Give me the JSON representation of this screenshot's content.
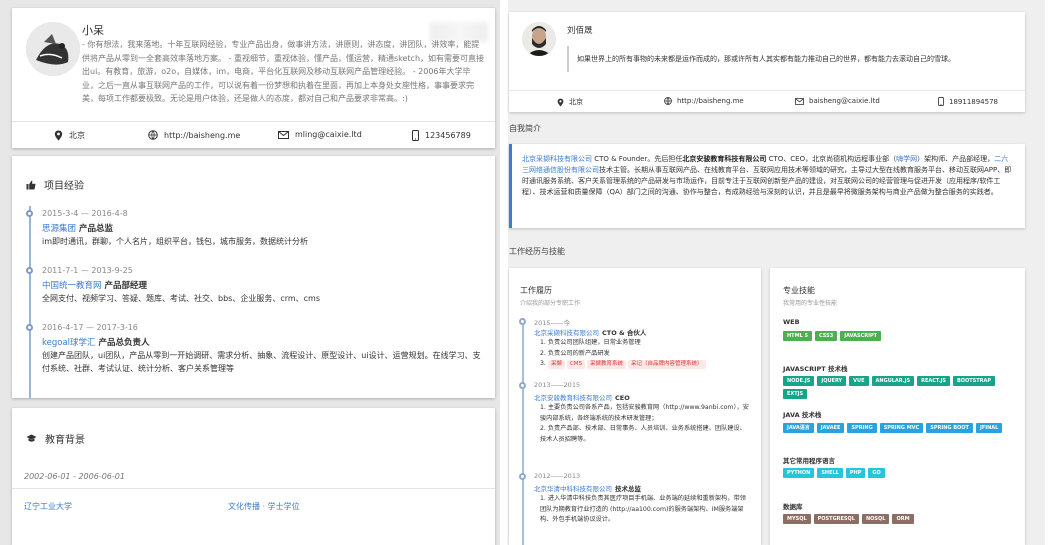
{
  "left": {
    "profile": {
      "name": "小呆",
      "bio": "- 你有想法，我来落地。十年互联网经验，专业产品出身，做事讲方法，讲原则，讲态度，讲团队，讲效率，能提供将产品从零到一全套高效率落地方案。 - 重视细节，重视体验，懂产品，懂运营，精通sketch，如有需要可直接出ui。有教育，旅游，o2o，自媒体，im，电商，平台化互联网及移动互联网产品管理经验。 - 2006年大学毕业，之后一直从事互联网产品的工作，可以说有着一份梦想和执着在里面，再加上本身处女座性格，事事要求完美，每项工作都要极致。无论是用户体验，还是做人的态度，都对自己和产品要求非常高。:)",
      "contact": {
        "location": "北京",
        "website": "http://baisheng.me",
        "email": "mling@caixie.ltd",
        "phone": "123456789"
      }
    },
    "projects": {
      "title": "项目经验",
      "items": [
        {
          "date": "2015-3-4 — 2016-4-8",
          "org": "思源集团",
          "role": "产品总监",
          "desc": "im即时通讯，群聊，个人名片，组织平台，钱包，城市服务，数据统计分析"
        },
        {
          "date": "2011-7-1 — 2013-9-25",
          "org": "中国统一教育网",
          "role": "产品部经理",
          "desc": "全网支付、视频学习、答疑、题库、考试、社交、bbs、企业服务、crm、cms"
        },
        {
          "date": "2016-4-17 — 2017-3-16",
          "org": "kegoal球学汇",
          "role": "产品总负责人",
          "desc": "创建产品团队，ui团队，产品从零到一开始调研、需求分析、抽象、流程设计、原型设计、ui设计、运营规划。在线学习、支付系统、社群、考试认证、统计分析、客户关系管理等"
        }
      ]
    },
    "education": {
      "title": "教育背景",
      "date": "2002-06-01 - 2006-06-01",
      "school": "辽宁工业大学",
      "major": "文化传播 · 学士学位"
    }
  },
  "right": {
    "profile": {
      "name": "刘佰晟",
      "quote": "如果世界上的所有事物的未来都是运作而成的，那或许所有人其实都有能力推动自己的世界，都有能力去滚动自己的雪球。",
      "contact": {
        "location": "北京",
        "website": "http://baisheng.me",
        "email": "baisheng@caixie.ltd",
        "phone": "18911894578"
      }
    },
    "intro": {
      "label": "自我简介",
      "parts": {
        "a": "北京采撷科技有限公司",
        "b": " CTO & Founder。先后担任",
        "c": "北京安骏教育科技有限公司",
        "d": " CTO、CEO，北京尚德机构远程事业部（",
        "e": "嗨学网",
        "f": "）架构师、产品部经理，",
        "g": "二六三网络通信股份有限公司",
        "h": "技术主管。长期从事互联网产品、在线教育平台、互联网应用技术等领域的研究，主导过大型在线教育服务平台、移动互联网APP、即时通讯服务系统、客户关系管理系统的产品研发与市场运作，目前专注于互联网创新型产品的建设，对互联网公司的经营管理与促进开发（应用程序/软件工程）、技术运营和质量保障（QA）部门之间的沟通、协作与整合，有成熟经验与深刻的认识，并且是最早将微服务架构与商业产品做为整合服务的实践者。"
      }
    },
    "work_label": "工作经历与技能",
    "work": {
      "title": "工作履历",
      "subtitle": "介绍我的部分专职工作",
      "items": [
        {
          "date": "2015——今",
          "org": "北京采撷科技有限公司",
          "role": "CTO & 合伙人",
          "list": [
            "1. 负责公司团队组建，日常业务管理",
            "2. 负责公司的新产品研发"
          ],
          "pills": [
            "采撷",
            "CMS",
            "采撷教育系统",
            "采记（自品牌内容管理系统）"
          ]
        },
        {
          "date": "2013——2015",
          "org": "北京安骏教育科技有限公司",
          "role": "CEO",
          "list": [
            "1. 主要负责公司各系产品，包括安骏教育网（http://www.9anbi.com），安骏内部系统，各终端系统的技术研发管理；",
            "2. 负责产品部、技术部、日常事务、人员培训、业务系统搭建、团队建设、技术人员招聘等。"
          ],
          "pills": []
        },
        {
          "date": "2012——2013",
          "org": "北京华清中科科技有限公司",
          "role": "技术总监",
          "list": [
            "1. 进入华清中科技负责其医疗项目手机端、业务端的延续和重新架构，带领团队为期教育行业打造的 (http://aa100.com)的服务端架构、IM服务端架构、外包手机端协议设计。"
          ],
          "pills": []
        }
      ]
    },
    "skills": {
      "title": "专业技能",
      "subtitle": "我常用的专业性技能",
      "groups": [
        {
          "name": "WEB",
          "color": "#4caf50",
          "tags": [
            "HTML 5",
            "CSS3",
            "JAVASCRIPT"
          ]
        },
        {
          "name": "JAVASCRIPT 技术栈",
          "color": "#17a589",
          "tags": [
            "NODE.JS",
            "JQUERY",
            "VUE",
            "ANGULAR.JS",
            "REACT.JS",
            "BOOTSTRAP",
            "EXTJS"
          ]
        },
        {
          "name": "JAVA 技术栈",
          "color": "#29a3e0",
          "tags": [
            "JAVA语言",
            "JAVAEE",
            "SPRING",
            "SPRING MVC",
            "SPRING BOOT",
            "JFINAL"
          ]
        },
        {
          "name": "其它常用程序语言",
          "color": "#26c6da",
          "tags": [
            "PYTHON",
            "SHELL",
            "PHP",
            "GO"
          ]
        },
        {
          "name": "数据库",
          "color": "#8d6e63",
          "tags": [
            "MYSQL",
            "POSTGRESQL",
            "NOSQL",
            "ORM"
          ]
        }
      ]
    }
  }
}
